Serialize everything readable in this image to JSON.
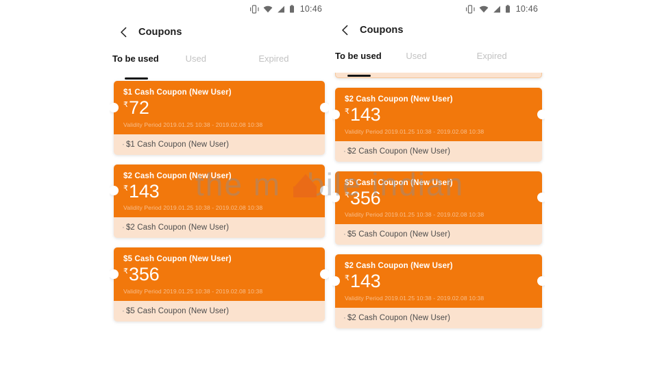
{
  "statusbar": {
    "time": "10:46",
    "icons": [
      "vibrate-icon",
      "wifi-icon",
      "signal-icon",
      "battery-icon"
    ]
  },
  "appbar": {
    "back_label": "back-arrow",
    "title": "Coupons"
  },
  "tabs": [
    {
      "label": "To be used",
      "active": true
    },
    {
      "label": "Used",
      "active": false
    },
    {
      "label": "Expired",
      "active": false
    }
  ],
  "colors": {
    "coupon_orange": "#F2780C",
    "coupon_footer": "#FBE2CE",
    "validity_text": "#F8BE8C",
    "tab_active": "#141414",
    "tab_inactive": "#c2c2c2",
    "page_background": "#FFFFFF"
  },
  "labels": {
    "currency_symbol": "₹",
    "foot_bullet": "·"
  },
  "watermark": {
    "text": "the mobile indian"
  },
  "left_panel": {
    "coupons": [
      {
        "title": "$1 Cash Coupon (New User)",
        "currency": "₹",
        "amount": "72",
        "validity": "Validity Period 2019.01.25 10:38 - 2019.02.08 10:38",
        "footer": "$1 Cash Coupon (New User)"
      },
      {
        "title": "$2 Cash Coupon (New User)",
        "currency": "₹",
        "amount": "143",
        "validity": "Validity Period 2019.01.25 10:38 - 2019.02.08 10:38",
        "footer": "$2 Cash Coupon (New User)"
      },
      {
        "title": "$5 Cash Coupon (New User)",
        "currency": "₹",
        "amount": "356",
        "validity": "Validity Period 2019.01.25 10:38 - 2019.02.08 10:38",
        "footer": "$5 Cash Coupon (New User)"
      }
    ]
  },
  "right_panel": {
    "coupons": [
      {
        "title": "$2 Cash Coupon (New User)",
        "currency": "₹",
        "amount": "143",
        "validity": "Validity Period 2019.01.25 10:38 - 2019.02.08 10:38",
        "footer": "$2 Cash Coupon (New User)"
      },
      {
        "title": "$5 Cash Coupon (New User)",
        "currency": "₹",
        "amount": "356",
        "validity": "Validity Period 2019.01.25 10:38 - 2019.02.08 10:38",
        "footer": "$5 Cash Coupon (New User)"
      },
      {
        "title": "$2 Cash Coupon (New User)",
        "currency": "₹",
        "amount": "143",
        "validity": "Validity Period 2019.01.25 10:38 - 2019.02.08 10:38",
        "footer": "$2 Cash Coupon (New User)"
      }
    ]
  }
}
